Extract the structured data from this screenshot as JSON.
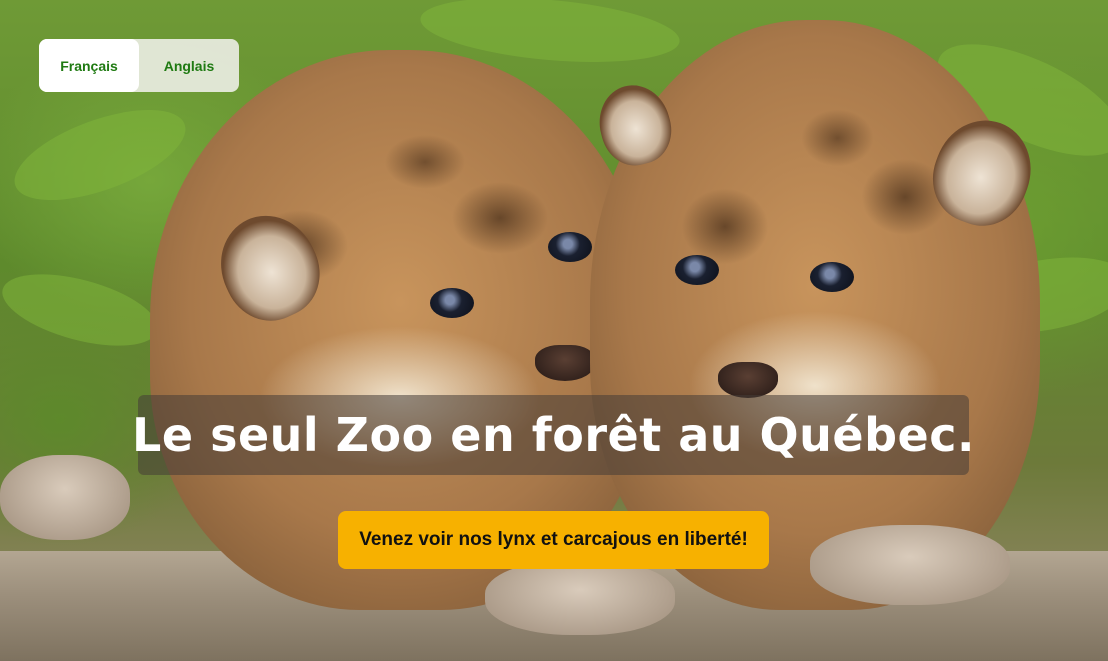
{
  "language_switcher": {
    "options": [
      {
        "label": "Français",
        "active": true
      },
      {
        "label": "Anglais",
        "active": false
      }
    ]
  },
  "hero": {
    "image_subject": "two-cougar-cubs-photo",
    "headline": "Le seul Zoo en forêt au Québec.",
    "cta_label": "Venez voir nos lynx et carcajous en liberté!"
  },
  "colors": {
    "cta_background": "#f7b100",
    "language_text": "#1f7a12",
    "headline_text": "#ffffff"
  }
}
